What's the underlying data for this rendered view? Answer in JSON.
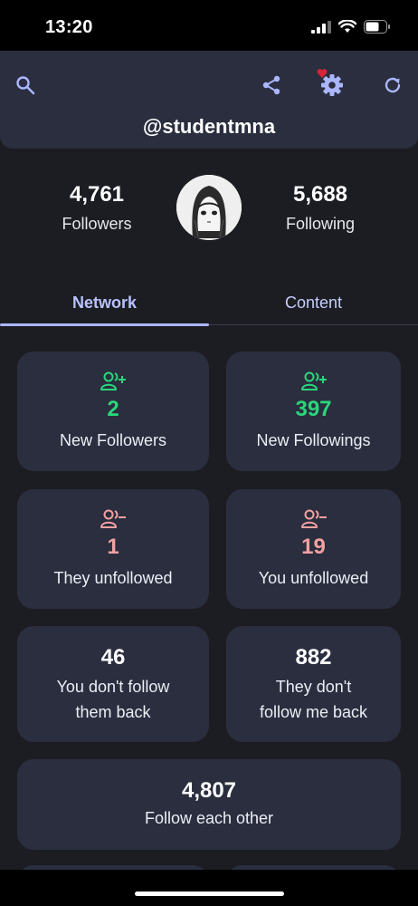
{
  "status": {
    "time": "13:20"
  },
  "header": {
    "handle": "@studentmna"
  },
  "profile": {
    "followers_count": "4,761",
    "followers_label": "Followers",
    "following_count": "5,688",
    "following_label": "Following"
  },
  "tabs": [
    {
      "label": "Network",
      "active": true
    },
    {
      "label": "Content",
      "active": false
    }
  ],
  "cards": {
    "new_followers": {
      "count": "2",
      "label": "New Followers"
    },
    "new_followings": {
      "count": "397",
      "label": "New Followings"
    },
    "they_unfollowed": {
      "count": "1",
      "label": "They unfollowed"
    },
    "you_unfollowed": {
      "count": "19",
      "label": "You unfollowed"
    },
    "you_dont_follow_back": {
      "count": "46",
      "line1": "You don't follow",
      "line2": "them back"
    },
    "they_dont_follow_back": {
      "count": "882",
      "line1": "They don't",
      "line2": "follow me back"
    },
    "mutual": {
      "count": "4,807",
      "label": "Follow each other"
    }
  },
  "colors": {
    "background": "#1c1d22",
    "card": "#2a2e3f",
    "accent": "#aab6ff",
    "positive": "#2bd67b",
    "negative": "#f3a1a1"
  },
  "icons": {
    "header": [
      "search-icon",
      "share-icon",
      "settings-icon",
      "heart-icon",
      "refresh-icon"
    ],
    "cards": [
      "person-add-icon",
      "person-remove-icon"
    ]
  }
}
